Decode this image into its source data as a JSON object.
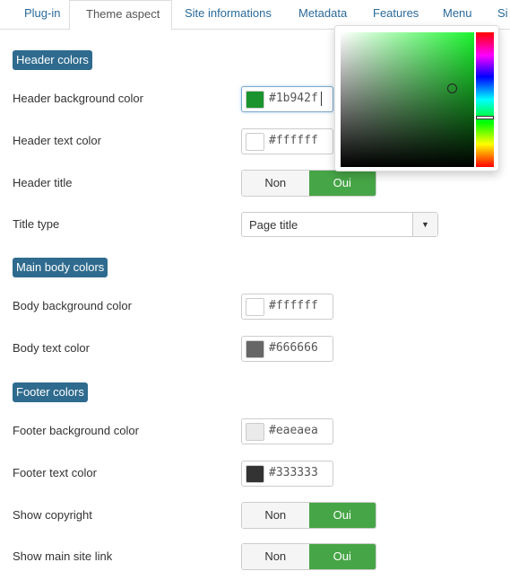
{
  "tabs": [
    {
      "label": "Plug-in"
    },
    {
      "label": "Theme aspect",
      "active": true
    },
    {
      "label": "Site informations"
    },
    {
      "label": "Metadata"
    },
    {
      "label": "Features"
    },
    {
      "label": "Menu"
    },
    {
      "label": "Si"
    }
  ],
  "sections": {
    "header": {
      "title": "Header colors",
      "bg_label": "Header background color",
      "bg_value": "#1b942f",
      "text_label": "Header text color",
      "text_value": "#ffffff",
      "title_label": "Header title",
      "title_type_label": "Title type",
      "title_type_value": "Page title"
    },
    "body": {
      "title": "Main body colors",
      "bg_label": "Body background color",
      "bg_value": "#ffffff",
      "text_label": "Body text color",
      "text_value": "#666666"
    },
    "footer": {
      "title": "Footer colors",
      "bg_label": "Footer background color",
      "bg_value": "#eaeaea",
      "text_label": "Footer text color",
      "text_value": "#333333",
      "copyright_label": "Show copyright",
      "site_link_label": "Show main site link"
    }
  },
  "toggle": {
    "off": "Non",
    "on": "Oui"
  },
  "colors": {
    "accent": "#46a546",
    "badge": "#2f6b8e",
    "link": "#2a6a9a"
  }
}
